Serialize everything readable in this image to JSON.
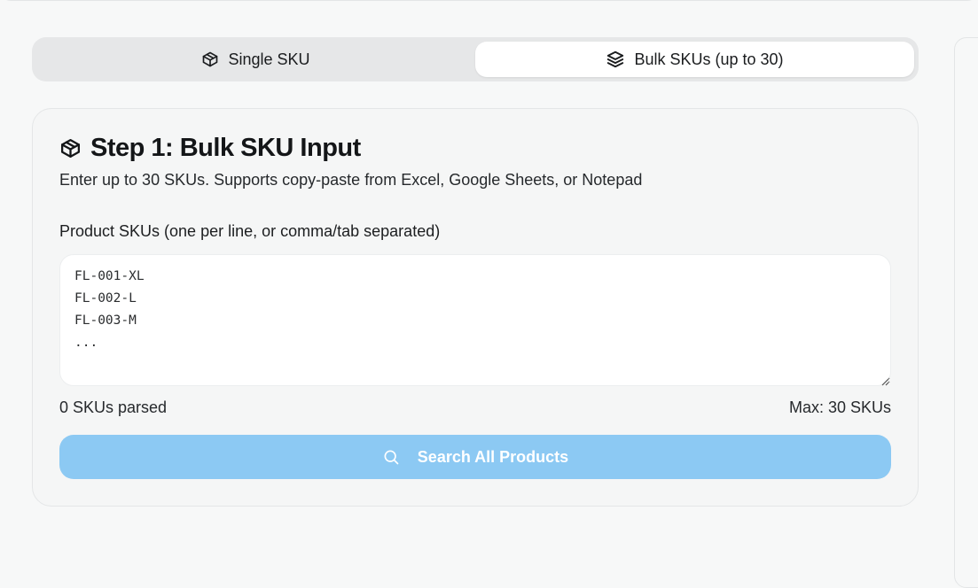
{
  "tabs": {
    "single": {
      "label": "Single SKU",
      "icon": "package-icon"
    },
    "bulk": {
      "label": "Bulk SKUs (up to 30)",
      "icon": "layers-icon",
      "active": true
    }
  },
  "card": {
    "title": "Step 1: Bulk SKU Input",
    "title_icon": "package-icon",
    "description": "Enter up to 30 SKUs. Supports copy-paste from Excel, Google Sheets, or Notepad",
    "field_label": "Product SKUs (one per line, or comma/tab separated)",
    "textarea": {
      "value": "",
      "placeholder": "FL-001-XL\nFL-002-L\nFL-003-M\n..."
    },
    "parsed_count": "0 SKUs parsed",
    "max_count": "Max: 30 SKUs",
    "search_button": {
      "label": "Search All Products",
      "icon": "search-icon",
      "disabled": true,
      "color": "#8cc9f3"
    }
  }
}
